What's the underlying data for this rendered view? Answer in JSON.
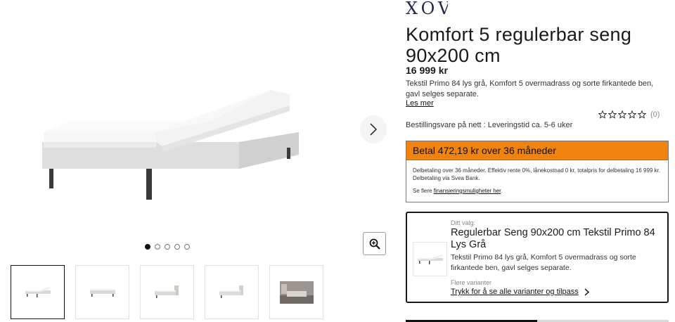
{
  "brand": {
    "logo_text": "XOV"
  },
  "product": {
    "title": "Komfort 5 regulerbar seng 90x200 cm",
    "price": "16 999 kr",
    "description": "Tekstil Primo 84 lys grå, Komfort 5 overmadrass og sorte firkantede ben, gavl selges separate.",
    "read_more": "Les mer",
    "rating": {
      "stars": 0,
      "max": 5,
      "count_label": "(0)"
    },
    "order_note": "Bestillingsvare på nett : Leveringstid ca. 5-6 uker"
  },
  "gallery": {
    "dots": 5,
    "active_dot": 0,
    "thumbnails": [
      "bed-plain",
      "bed-low",
      "bed-headboard",
      "bed-headboard-2",
      "room-scene"
    ]
  },
  "financing": {
    "headline": "Betal 472,19 kr over 36 måneder",
    "details": "Delbetaling over 36 måneder. Effektiv rente 0%, lånekostnad 0 kr, totalpris for delbetaling 16 999 kr. Delbetaling via Svea Bank.",
    "more_prefix": "Se flere ",
    "more_link": "finansieringsmuligheter her",
    "more_suffix": ".",
    "accent_color": "#f0830f"
  },
  "variant": {
    "label": "Ditt valg:",
    "name": "Regulerbar Seng 90x200 cm Tekstil Primo 84 Lys Grå",
    "description": "Tekstil Primo 84 lys grå, Komfort 5 overmadrass og sorte firkantede ben, gavl selges separate.",
    "more_label": "Flere varianter",
    "link": "Trykk for å se alle varianter og tilpass"
  },
  "scroll_progress": 0.5
}
